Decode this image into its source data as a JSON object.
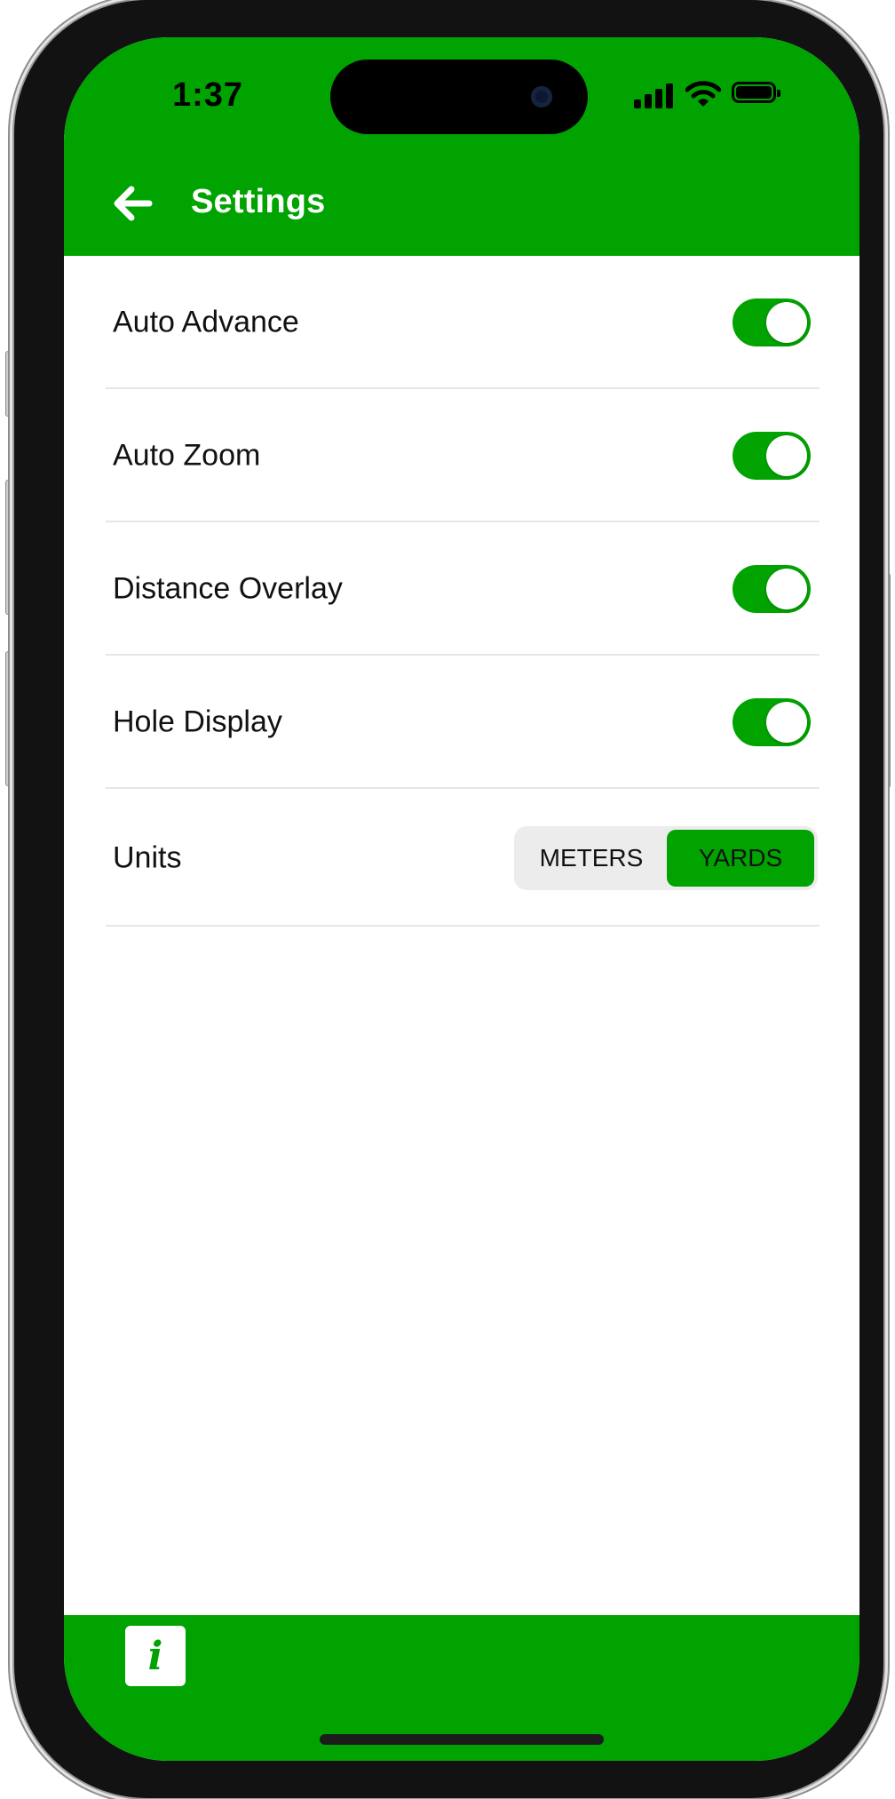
{
  "status_bar": {
    "time": "1:37"
  },
  "header": {
    "back_icon": "arrow-left-icon",
    "title": "Settings"
  },
  "settings": [
    {
      "label": "Auto Advance",
      "control": "toggle",
      "on": true
    },
    {
      "label": "Auto Zoom",
      "control": "toggle",
      "on": true
    },
    {
      "label": "Distance Overlay",
      "control": "toggle",
      "on": true
    },
    {
      "label": "Hole Display",
      "control": "toggle",
      "on": true
    }
  ],
  "units": {
    "label": "Units",
    "options": [
      "METERS",
      "YARDS"
    ],
    "selected": "YARDS"
  },
  "footer": {
    "info_label": "i",
    "info_icon": "info-icon"
  },
  "colors": {
    "accent": "#00a300",
    "toggle_knob": "#ffffff",
    "segment_track": "#ececec",
    "divider": "#e6e6e6"
  }
}
